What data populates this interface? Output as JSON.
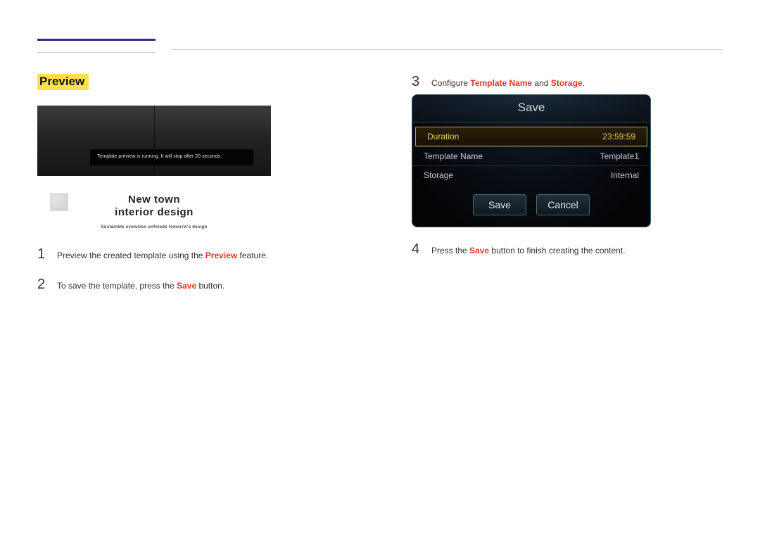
{
  "heading": "Preview",
  "preview": {
    "toast": "Template preview is running. It will stop after 20 seconds.",
    "title1": "New town",
    "title2": "interior design",
    "tagline": "Sustainble evolution unfolods tomorrw's design"
  },
  "left_steps": [
    {
      "num": "1",
      "pre": "Preview the created template using the ",
      "hl": "Preview",
      "post": " feature."
    },
    {
      "num": "2",
      "pre": "To save the template, press the ",
      "hl": "Save",
      "post": " button."
    }
  ],
  "right_steps": {
    "s3": {
      "num": "3",
      "pre": "Configure ",
      "hl1": "Template Name",
      "mid": " and ",
      "hl2": "Storage",
      "post": "."
    },
    "s4": {
      "num": "4",
      "pre": "Press the ",
      "hl": "Save",
      "post": " button to finish creating the content."
    }
  },
  "dialog": {
    "title": "Save",
    "rows": [
      {
        "label": "Duration",
        "value": "23:59:59",
        "highlight": true
      },
      {
        "label": "Template Name",
        "value": "Template1",
        "highlight": false
      },
      {
        "label": "Storage",
        "value": "Internal",
        "highlight": false
      }
    ],
    "buttons": {
      "save": "Save",
      "cancel": "Cancel"
    }
  }
}
